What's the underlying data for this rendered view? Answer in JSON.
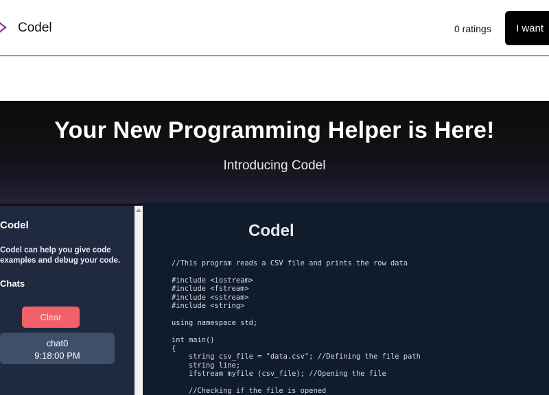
{
  "header": {
    "brand": "Codel",
    "ratings": "0 ratings",
    "cta_label": "I want"
  },
  "hero": {
    "title": "Your New Programming Helper is Here!",
    "subtitle": "Introducing Codel"
  },
  "app": {
    "sidebar": {
      "title": "Codel",
      "description": "Codel can help you give code examples and debug your code.",
      "chats_heading": "Chats",
      "clear_label": "Clear",
      "chat": {
        "name": "chat0",
        "time": "9:18:00 PM"
      }
    },
    "main": {
      "title": "Codel",
      "code_lines": [
        "//This program reads a CSV file and prints the row data",
        "",
        "#include <iostream>",
        "#include <fstream>",
        "#include <sstream>",
        "#include <string>",
        "",
        "using namespace std;",
        "",
        "int main()",
        "{",
        "    string csv_file = \"data.csv\"; //Defining the file path",
        "    string line;",
        "    ifstream myfile (csv_file); //Opening the file",
        "",
        "    //Checking if the file is opened"
      ]
    }
  },
  "colors": {
    "cta_bg": "#000000",
    "clear_button": "#f0616a",
    "sidebar_bg": "#1f2940",
    "editor_bg": "#101b2b",
    "logo_accent": "#e58be0"
  },
  "icons": {
    "logo": "codel-logo-icon"
  }
}
